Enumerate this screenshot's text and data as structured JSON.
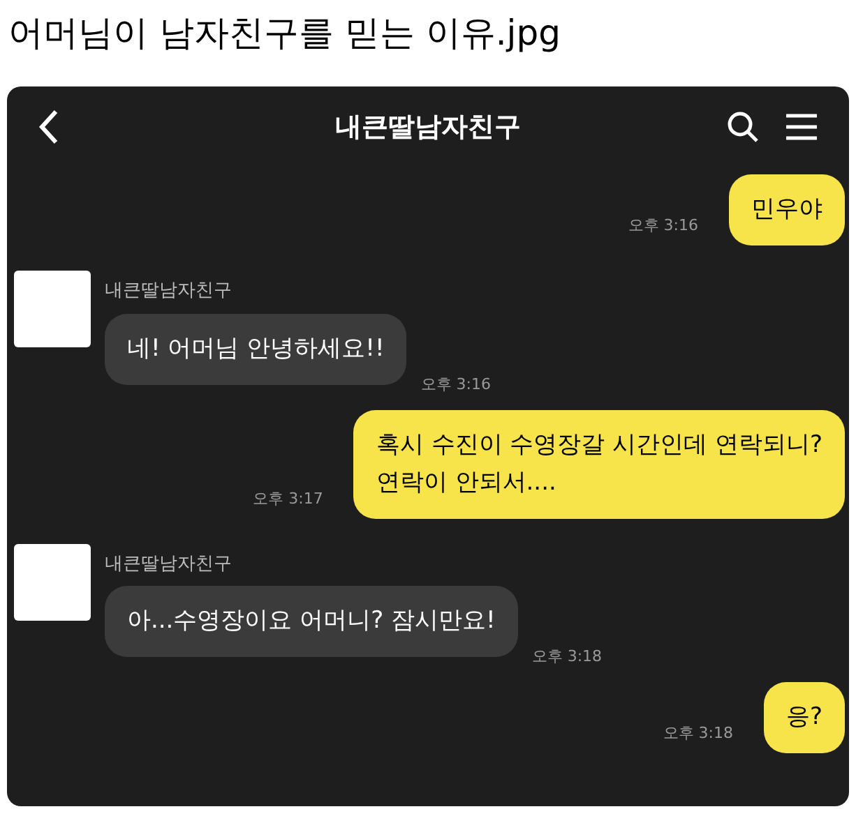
{
  "post_title": "어머님이 남자친구를 믿는 이유.jpg",
  "chat": {
    "title": "내큰딸남자친구",
    "messages": [
      {
        "kind": "sent",
        "lines": [
          "민우야"
        ],
        "time": "오후 3:16"
      },
      {
        "kind": "received",
        "sender": "내큰딸남자친구",
        "lines": [
          "네! 어머님 안녕하세요!!"
        ],
        "time": "오후 3:16"
      },
      {
        "kind": "sent",
        "lines": [
          "혹시 수진이 수영장갈 시간인데 연락되니?",
          "연락이 안되서...."
        ],
        "time": "오후 3:17"
      },
      {
        "kind": "received",
        "sender": "내큰딸남자친구",
        "lines": [
          "아...수영장이요 어머니? 잠시만요!"
        ],
        "time": "오후 3:18"
      },
      {
        "kind": "sent",
        "lines": [
          "응?"
        ],
        "time": "오후 3:18"
      }
    ]
  }
}
